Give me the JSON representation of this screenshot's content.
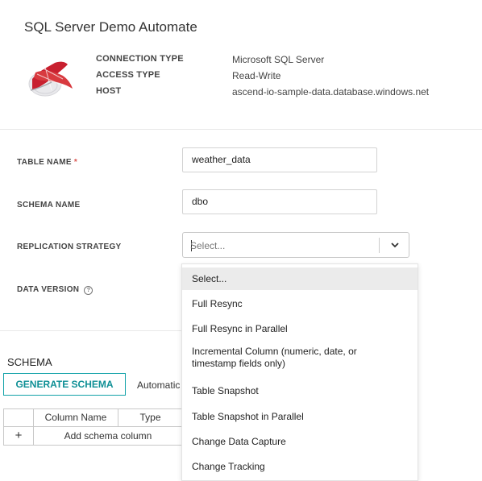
{
  "header": {
    "title": "SQL Server Demo Automate",
    "meta": [
      {
        "label": "CONNECTION TYPE",
        "value": "Microsoft SQL Server"
      },
      {
        "label": "ACCESS TYPE",
        "value": "Read-Write"
      },
      {
        "label": "HOST",
        "value": "ascend-io-sample-data.database.windows.net"
      }
    ]
  },
  "form": {
    "table_name": {
      "label": "TABLE NAME",
      "required_mark": "*",
      "value": "weather_data"
    },
    "schema_name": {
      "label": "SCHEMA NAME",
      "value": "dbo"
    },
    "replication_strategy": {
      "label": "REPLICATION STRATEGY",
      "selected": "Select..."
    },
    "data_version": {
      "label": "DATA VERSION",
      "help_glyph": "?"
    }
  },
  "dropdown": {
    "options": [
      "Select...",
      "Full Resync",
      "Full Resync in Parallel",
      "Incremental Column (numeric, date, or timestamp fields only)",
      "Table Snapshot",
      "Table Snapshot in Parallel",
      "Change Data Capture",
      "Change Tracking"
    ],
    "option_lines": {
      "incremental_line1": "Incremental Column (numeric, date, or",
      "incremental_line2": "timestamp fields only)"
    },
    "active_index": 0
  },
  "schema": {
    "title": "SCHEMA",
    "generate_button": "GENERATE SCHEMA",
    "automatic_text": "Automatic",
    "columns": [
      "Column Name",
      "Type"
    ],
    "add_icon": "+",
    "add_row_label": "Add schema column"
  },
  "colors": {
    "accent": "#12a2a8",
    "required": "#d9534f",
    "logo_red": "#c8202f"
  },
  "icons": {
    "logo": "sql-server-logo-icon",
    "chevron": "chevron-down-icon",
    "help": "help-circle-icon",
    "add": "plus-icon"
  }
}
